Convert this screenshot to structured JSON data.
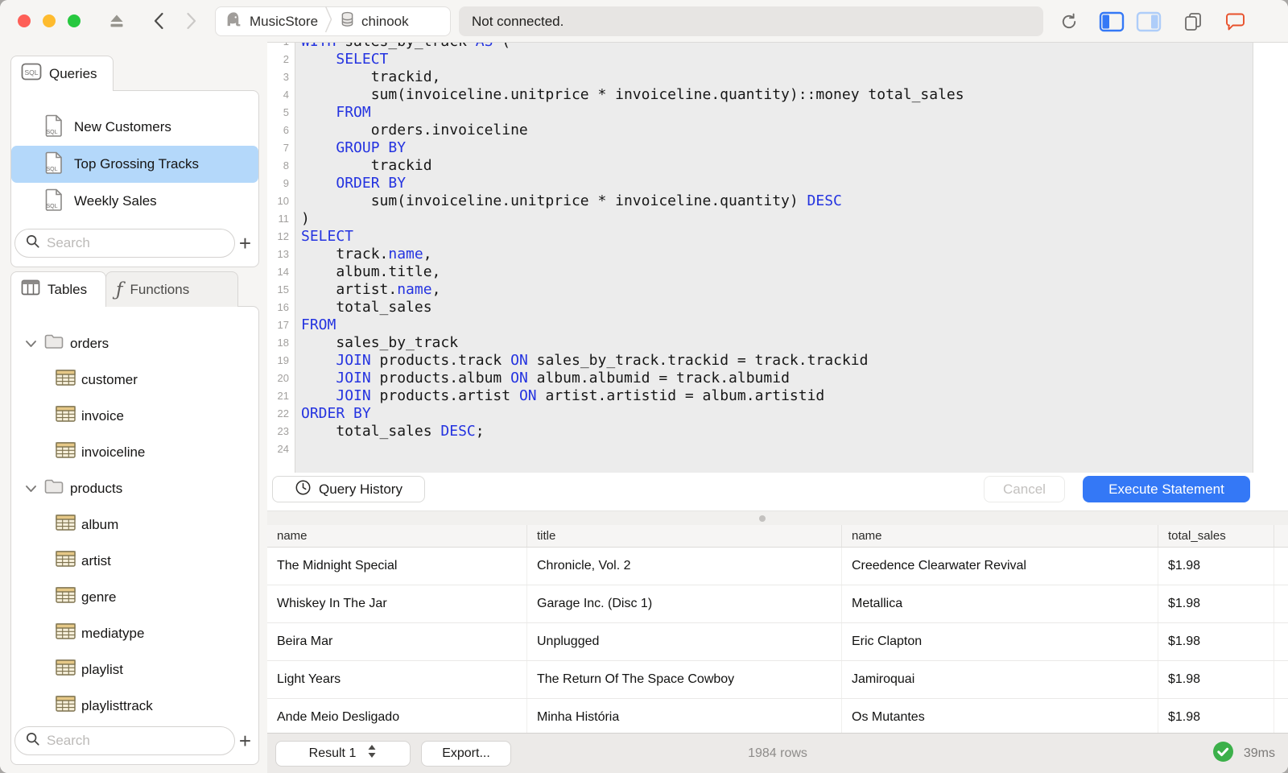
{
  "titlebar": {
    "breadcrumb": {
      "server": "MusicStore",
      "database": "chinook"
    },
    "status": "Not connected."
  },
  "sidebar": {
    "queries": {
      "tab_label": "Queries",
      "items": [
        {
          "label": "New Customers",
          "selected": false
        },
        {
          "label": "Top Grossing Tracks",
          "selected": true
        },
        {
          "label": "Weekly Sales",
          "selected": false
        }
      ],
      "search_placeholder": "Search",
      "add_label": "+"
    },
    "schema": {
      "tables_tab": "Tables",
      "functions_tab": "Functions",
      "tree": [
        {
          "type": "folder",
          "label": "orders"
        },
        {
          "type": "table",
          "label": "customer"
        },
        {
          "type": "table",
          "label": "invoice"
        },
        {
          "type": "table",
          "label": "invoiceline"
        },
        {
          "type": "folder",
          "label": "products"
        },
        {
          "type": "table",
          "label": "album"
        },
        {
          "type": "table",
          "label": "artist"
        },
        {
          "type": "table",
          "label": "genre"
        },
        {
          "type": "table",
          "label": "mediatype"
        },
        {
          "type": "table",
          "label": "playlist"
        },
        {
          "type": "table",
          "label": "playlisttrack"
        }
      ],
      "search_placeholder": "Search",
      "add_label": "+"
    }
  },
  "editor": {
    "lines": [
      [
        [
          "WITH",
          1
        ],
        [
          " sales_by_track ",
          0
        ],
        [
          "AS",
          1
        ],
        [
          " (",
          0
        ]
      ],
      [
        [
          "    ",
          0
        ],
        [
          "SELECT",
          1
        ]
      ],
      [
        [
          "        trackid,",
          0
        ]
      ],
      [
        [
          "        sum(invoiceline.unitprice * invoiceline.quantity)::money total_sales",
          0
        ]
      ],
      [
        [
          "    ",
          0
        ],
        [
          "FROM",
          1
        ]
      ],
      [
        [
          "        orders.invoiceline",
          0
        ]
      ],
      [
        [
          "    ",
          0
        ],
        [
          "GROUP BY",
          1
        ]
      ],
      [
        [
          "        trackid",
          0
        ]
      ],
      [
        [
          "    ",
          0
        ],
        [
          "ORDER BY",
          1
        ]
      ],
      [
        [
          "        sum(invoiceline.unitprice * invoiceline.quantity) ",
          0
        ],
        [
          "DESC",
          1
        ]
      ],
      [
        [
          ")",
          0
        ]
      ],
      [
        [
          "SELECT",
          1
        ]
      ],
      [
        [
          "    track.",
          0
        ],
        [
          "name",
          1
        ],
        [
          ",",
          0
        ]
      ],
      [
        [
          "    album.title,",
          0
        ]
      ],
      [
        [
          "    artist.",
          0
        ],
        [
          "name",
          1
        ],
        [
          ",",
          0
        ]
      ],
      [
        [
          "    total_sales",
          0
        ]
      ],
      [
        [
          "FROM",
          1
        ]
      ],
      [
        [
          "    sales_by_track",
          0
        ]
      ],
      [
        [
          "    ",
          0
        ],
        [
          "JOIN",
          1
        ],
        [
          " products.track ",
          0
        ],
        [
          "ON",
          1
        ],
        [
          " sales_by_track.trackid = track.trackid",
          0
        ]
      ],
      [
        [
          "    ",
          0
        ],
        [
          "JOIN",
          1
        ],
        [
          " products.album ",
          0
        ],
        [
          "ON",
          1
        ],
        [
          " album.albumid = track.albumid",
          0
        ]
      ],
      [
        [
          "    ",
          0
        ],
        [
          "JOIN",
          1
        ],
        [
          " products.artist ",
          0
        ],
        [
          "ON",
          1
        ],
        [
          " artist.artistid = album.artistid",
          0
        ]
      ],
      [
        [
          "ORDER BY",
          1
        ]
      ],
      [
        [
          "    total_sales ",
          0
        ],
        [
          "DESC",
          1
        ],
        [
          ";",
          0
        ]
      ],
      [
        [
          "",
          0
        ]
      ]
    ]
  },
  "actions": {
    "query_history": "Query History",
    "cancel": "Cancel",
    "execute": "Execute Statement"
  },
  "results": {
    "columns": [
      "name",
      "title",
      "name",
      "total_sales"
    ],
    "rows": [
      [
        "The Midnight Special",
        "Chronicle, Vol. 2",
        "Creedence Clearwater Revival",
        "$1.98"
      ],
      [
        "Whiskey In The Jar",
        "Garage Inc. (Disc 1)",
        "Metallica",
        "$1.98"
      ],
      [
        "Beira Mar",
        "Unplugged",
        "Eric Clapton",
        "$1.98"
      ],
      [
        "Light Years",
        "The Return Of The Space Cowboy",
        "Jamiroquai",
        "$1.98"
      ],
      [
        "Ande Meio Desligado",
        "Minha História",
        "Os Mutantes",
        "$1.98"
      ]
    ]
  },
  "statusbar": {
    "result_selector": "Result 1",
    "export": "Export...",
    "row_count": "1984 rows",
    "duration": "39ms"
  },
  "colors": {
    "accent": "#3478f6",
    "keyword": "#2433e0",
    "selection": "#b4d8fa",
    "success": "#3cb04a"
  }
}
